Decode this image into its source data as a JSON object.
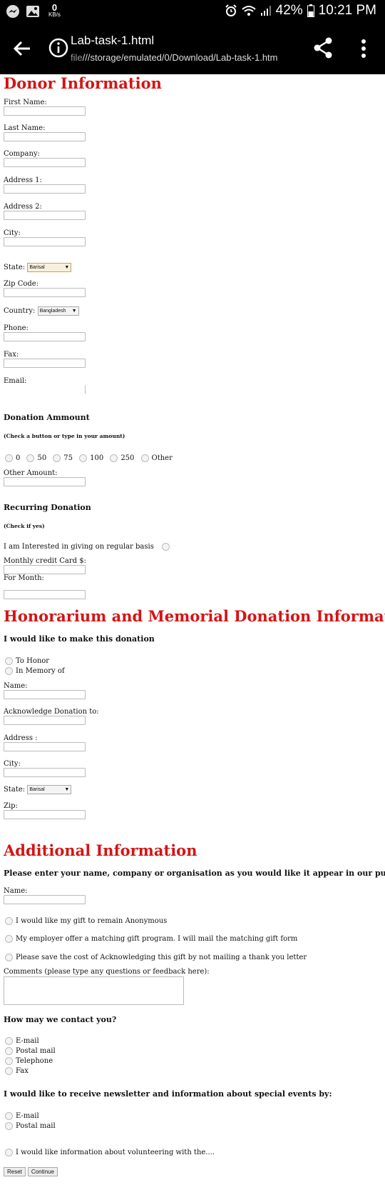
{
  "status": {
    "kbs_value": "0",
    "kbs_unit": "KB/s",
    "battery": "42%",
    "time": "10:21 PM"
  },
  "browser": {
    "title": "Lab-task-1.html",
    "url_scheme": "file",
    "url_rest": "///storage/emulated/0/Download/Lab-task-1.htm"
  },
  "donor": {
    "heading": "Donor Information",
    "first_name": "First Name:",
    "last_name": "Last Name:",
    "company": "Company:",
    "address1": "Address 1:",
    "address2": "Address 2:",
    "city": "City:",
    "state": "State:",
    "state_value": "Barisal",
    "zip": "Zip Code:",
    "country": "Country:",
    "country_value": "Bangladesh",
    "phone": "Phone:",
    "fax": "Fax:",
    "email": "Email:"
  },
  "donation": {
    "heading": "Donation Ammount",
    "note": "(Check a button or type in your amount)",
    "options": [
      "0",
      "50",
      "75",
      "100",
      "250",
      "Other"
    ],
    "other_amount": "Other Amount:"
  },
  "recurring": {
    "heading": "Recurring Donation",
    "note": "(Check if yes)",
    "interest": "I am Interested in giving on regular basis",
    "monthly": "Monthly credit Card $:",
    "for_month": "For Month:"
  },
  "honorarium": {
    "heading": "Honorarium and Memorial Donation Information",
    "subheading": "I would like to make this donation",
    "to_honor": "To Honor",
    "in_memory": "In Memory of",
    "name": "Name:",
    "acknowledge": "Acknowledge Donation to:",
    "address": "Address :",
    "city": "City:",
    "state": "State:",
    "state_value": "Barisal",
    "zip": "Zip:"
  },
  "additional": {
    "heading": "Additional Information",
    "prompt": "Please enter your name, company or organisation as you would like it appear in our publicati",
    "name": "Name:",
    "anonymous": "I would like my gift to remain Anonymous",
    "matching": "My employer offer a matching gift program. I will mail the matching gift form",
    "save_cost": "Please save the cost of Acknowledging this gift by not mailing a thank you letter",
    "comments": "Comments (please type any questions or feedback here):"
  },
  "contact": {
    "heading": "How may we contact you?",
    "options": [
      "E-mail",
      "Postal mail",
      "Telephone",
      "Fax"
    ]
  },
  "newsletter": {
    "heading": "I would like to receive newsletter and information about special events by:",
    "options": [
      "E-mail",
      "Postal mail"
    ]
  },
  "volunteer": "I would like information about volunteering with the....",
  "buttons": {
    "reset": "Reset",
    "continue": "Continue"
  }
}
